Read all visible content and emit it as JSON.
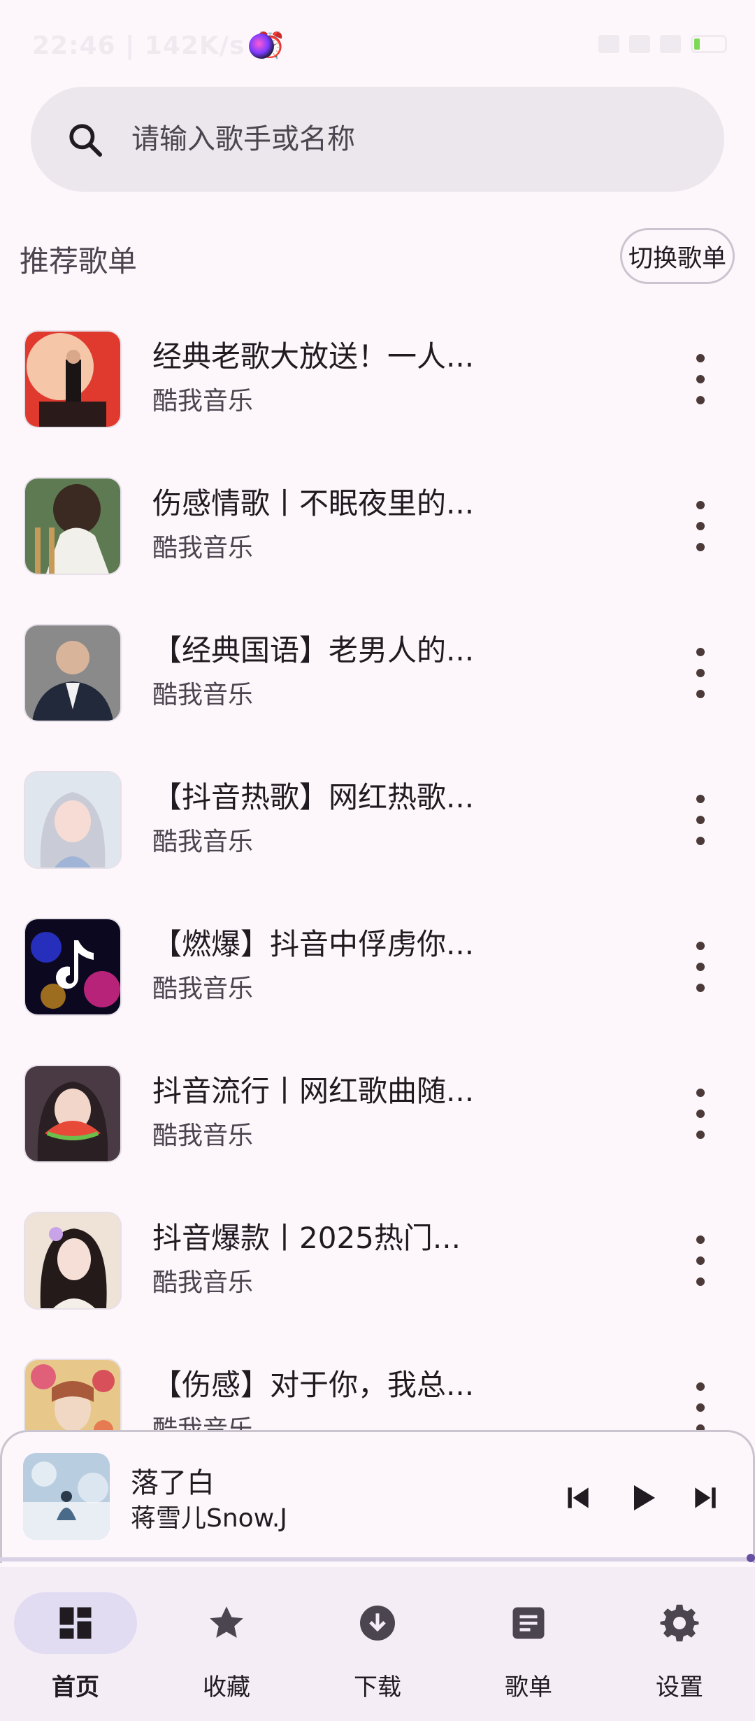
{
  "status_bar": {
    "left_text": "22:46 | 142K/s ⏰"
  },
  "search": {
    "placeholder": "请输入歌手或名称"
  },
  "section": {
    "title": "推荐歌单",
    "switch_label": "切换歌单"
  },
  "playlists": [
    {
      "title": "经典老歌大放送！一人...",
      "subtitle": "酷我音乐"
    },
    {
      "title": "伤感情歌丨不眠夜里的...",
      "subtitle": "酷我音乐"
    },
    {
      "title": "【经典国语】老男人的...",
      "subtitle": "酷我音乐"
    },
    {
      "title": "【抖音热歌】网红热歌...",
      "subtitle": "酷我音乐"
    },
    {
      "title": "【燃爆】抖音中俘虏你...",
      "subtitle": "酷我音乐"
    },
    {
      "title": "抖音流行丨网红歌曲随...",
      "subtitle": "酷我音乐"
    },
    {
      "title": "抖音爆款丨2025热门...",
      "subtitle": "酷我音乐"
    },
    {
      "title": "【伤感】对于你，我总...",
      "subtitle": "酷我音乐"
    }
  ],
  "player": {
    "title": "落了白",
    "artist": "蒋雪儿Snow.J",
    "progress": 0.99
  },
  "nav": {
    "items": [
      {
        "label": "首页",
        "icon": "dashboard-icon",
        "active": true
      },
      {
        "label": "收藏",
        "icon": "star-icon",
        "active": false
      },
      {
        "label": "下载",
        "icon": "download-icon",
        "active": false
      },
      {
        "label": "歌单",
        "icon": "list-icon",
        "active": false
      },
      {
        "label": "设置",
        "icon": "gear-icon",
        "active": false
      }
    ]
  },
  "colors": {
    "background": "#fdf7fc",
    "search_bg": "#ece6ed",
    "nav_bg": "#f4edf5",
    "active_pill": "#e1dcf2",
    "accent": "#6750a4"
  }
}
